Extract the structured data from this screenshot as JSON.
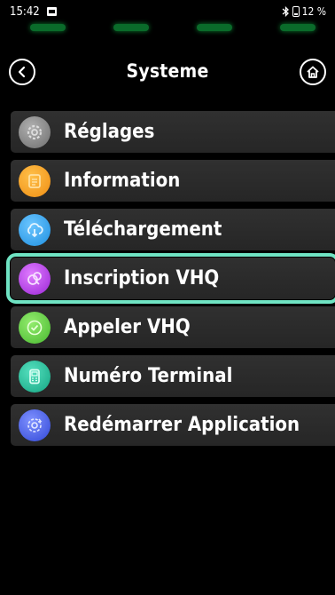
{
  "status_bar": {
    "time": "15:42",
    "battery": "12 %"
  },
  "header": {
    "title": "Systeme"
  },
  "menu": {
    "items": [
      {
        "label": "Réglages",
        "icon": "settings-icon",
        "color": "#8a8a8a"
      },
      {
        "label": "Information",
        "icon": "info-document-icon",
        "color": "#f5a51e"
      },
      {
        "label": "Téléchargement",
        "icon": "cloud-download-icon",
        "color": "#35a6f2"
      },
      {
        "label": "Inscription VHQ",
        "icon": "registration-icon",
        "color": "#b83ae8",
        "selected": true
      },
      {
        "label": "Appeler VHQ",
        "icon": "check-icon",
        "color": "#64d24a"
      },
      {
        "label": "Numéro Terminal",
        "icon": "terminal-icon",
        "color": "#1fbf9a"
      },
      {
        "label": "Redémarrer Application",
        "icon": "restart-icon",
        "color": "#4a63e8"
      }
    ]
  },
  "colors": {
    "selection_outline": "#6fe3c3",
    "item_background": "#2b2b2b",
    "led_green": "#0a6b2a"
  }
}
